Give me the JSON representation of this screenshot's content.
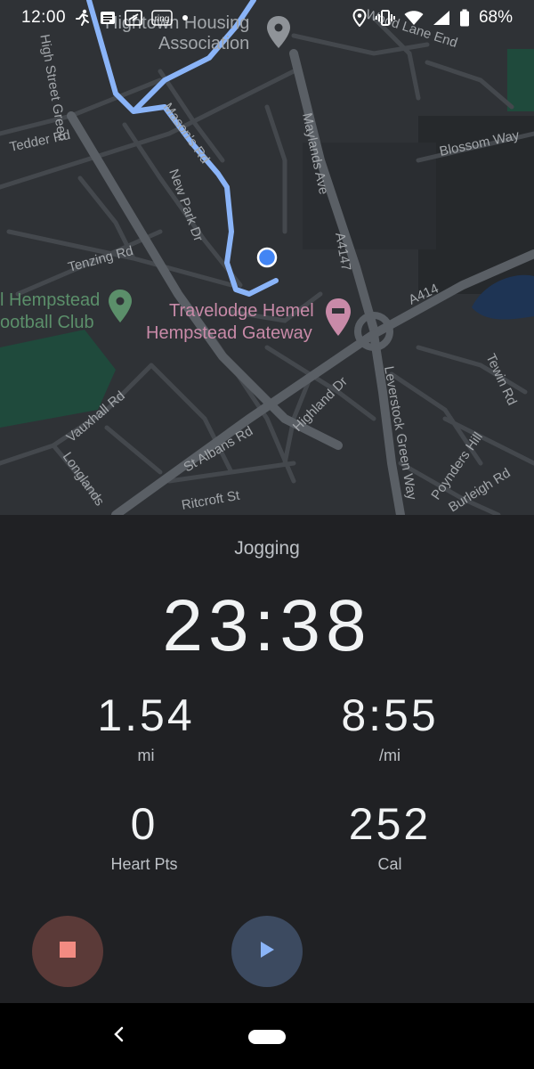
{
  "status_bar": {
    "time": "12:00",
    "battery": "68%",
    "icons": [
      "running-icon",
      "message-icon",
      "flight-icon",
      "ring-icon",
      "dot-icon",
      "location-icon",
      "vibrate-icon",
      "wifi-icon",
      "signal-icon",
      "battery-icon"
    ],
    "ring_label": "ring"
  },
  "map": {
    "labels": {
      "high_street_green": "High Street Green",
      "tedder_rd": "Tedder Rd",
      "masons_rd": "Mason's Rd",
      "new_park_dr": "New Park Dr",
      "tenzing_rd": "Tenzing Rd",
      "maylands_ave": "Maylands Ave",
      "a4147": "A4147",
      "a414": "A414",
      "blossom_way": "Blossom Way",
      "wood_lane_end": "Wood Lane End",
      "housing_assoc_1": "Hightown Housing",
      "housing_assoc_2": "Association",
      "football_1": "l Hempstead",
      "football_2": "ootball Club",
      "travelodge_1": "Travelodge Hemel",
      "travelodge_2": "Hempstead Gateway",
      "vauxhall_rd": "Vauxhall Rd",
      "longlands": "Longlands",
      "st_albans_rd": "St Albans Rd",
      "highland_dr": "Highland Dr",
      "ritcroft_st": "Ritcroft St",
      "leverstock_green_way": "Leverstock Green Way",
      "tewin_rd": "Tewin Rd",
      "poynders_hill": "Poynders Hill",
      "burleigh_rd": "Burleigh Rd"
    },
    "colors": {
      "route": "#8ab4f8",
      "location_dot": "#4285f4",
      "park": "#1f4a3c",
      "water": "#1e3454",
      "poi_label": "#c88aa8",
      "poi_green": "#5b8f6a"
    }
  },
  "workout": {
    "activity": "Jogging",
    "duration": "23:38",
    "stats": [
      {
        "value": "1.54",
        "unit": "mi"
      },
      {
        "value": "8:55",
        "unit": "/mi"
      },
      {
        "value": "0",
        "unit": "Heart Pts"
      },
      {
        "value": "252",
        "unit": "Cal"
      }
    ],
    "stop_color": "#f28b82",
    "play_color": "#8ab4f8"
  }
}
